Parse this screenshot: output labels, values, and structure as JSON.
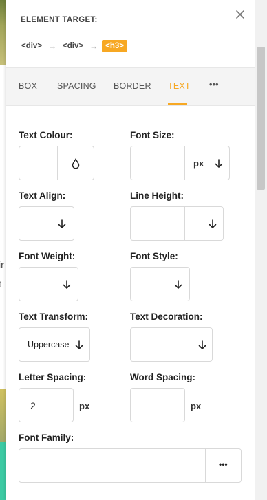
{
  "panel": {
    "title": "ELEMENT TARGET:",
    "breadcrumb": [
      "<div>",
      "<div>",
      "<h3>"
    ],
    "tabs": [
      "BOX",
      "SPACING",
      "BORDER",
      "TEXT",
      "•••"
    ],
    "active_tab": "TEXT"
  },
  "fields": {
    "text_colour": {
      "label": "Text Colour:",
      "value": ""
    },
    "font_size": {
      "label": "Font Size:",
      "value": "",
      "unit": "px"
    },
    "text_align": {
      "label": "Text Align:",
      "value": ""
    },
    "line_height": {
      "label": "Line Height:",
      "value": ""
    },
    "font_weight": {
      "label": "Font Weight:",
      "value": ""
    },
    "font_style": {
      "label": "Font Style:",
      "value": ""
    },
    "text_transform": {
      "label": "Text Transform:",
      "value": "Uppercase"
    },
    "text_decoration": {
      "label": "Text Decoration:",
      "value": ""
    },
    "letter_spacing": {
      "label": "Letter Spacing:",
      "value": "2",
      "unit": "px"
    },
    "word_spacing": {
      "label": "Word Spacing:",
      "value": "",
      "unit": "px"
    },
    "font_family": {
      "label": "Font Family:",
      "value": "",
      "more": "•••"
    }
  },
  "background_text": [
    "ir",
    "t"
  ],
  "colors": {
    "accent": "#f7a823",
    "border": "#d9d9d9"
  }
}
